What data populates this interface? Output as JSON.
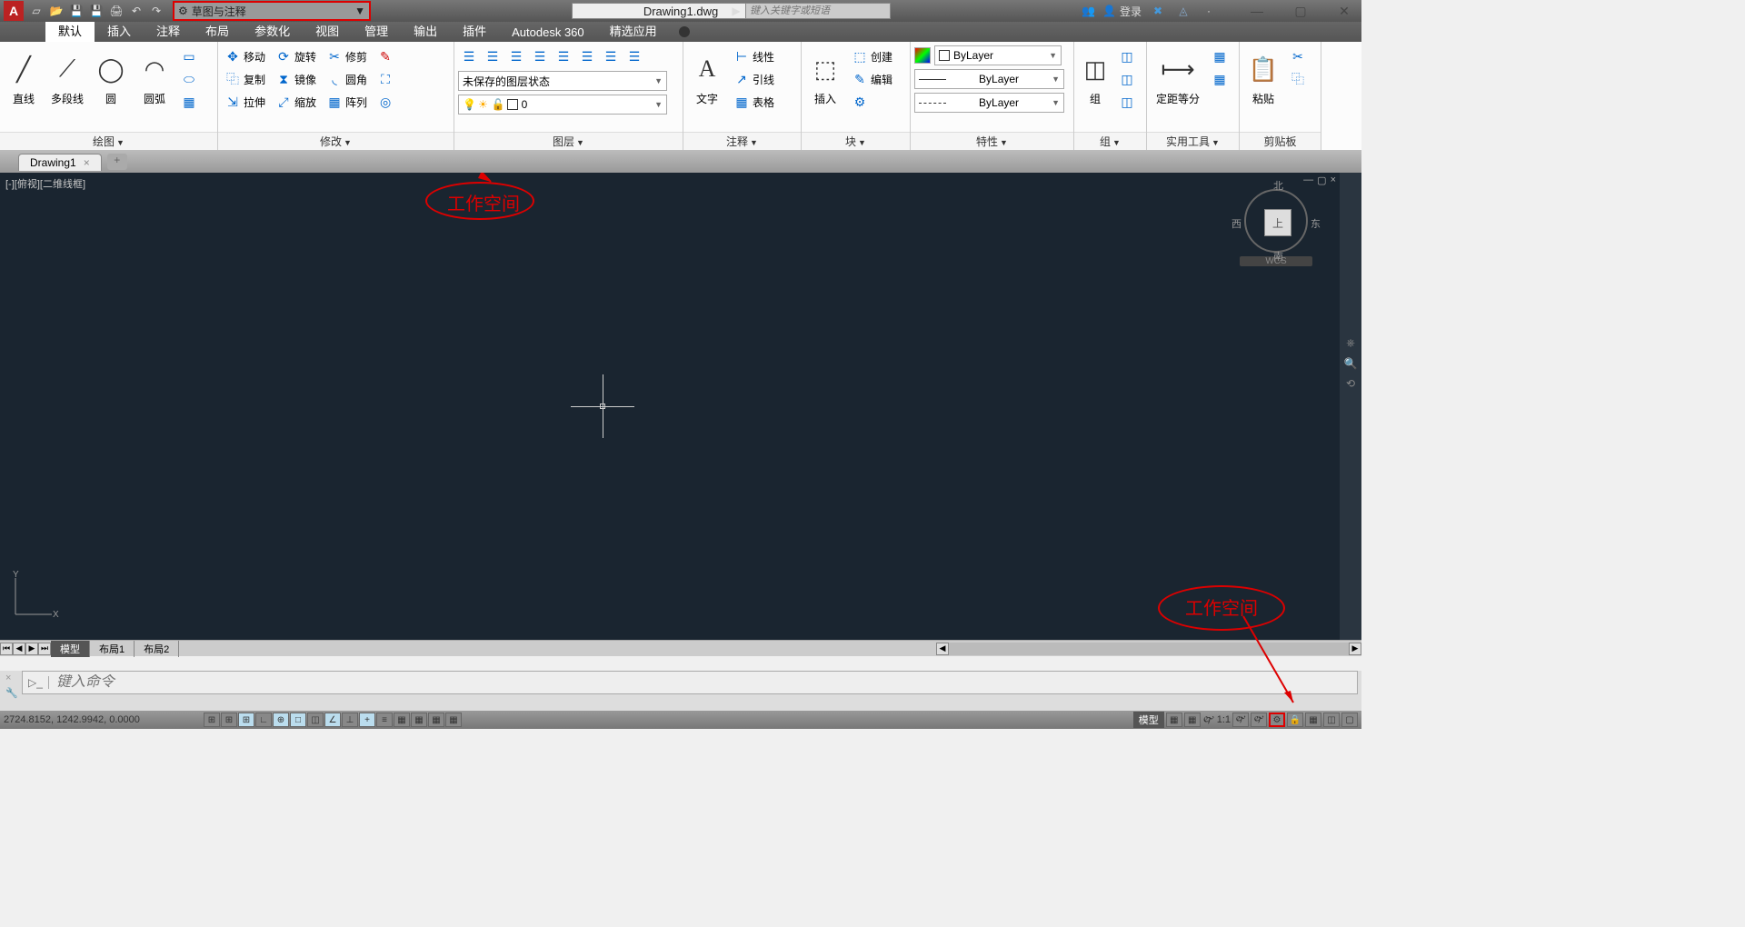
{
  "titlebar": {
    "filename": "Drawing1.dwg",
    "search_placeholder": "键入关键字或短语",
    "login": "登录"
  },
  "workspace": {
    "label": "草图与注释"
  },
  "ribbon_tabs": [
    {
      "label": "默认",
      "active": true
    },
    {
      "label": "插入",
      "active": false
    },
    {
      "label": "注释",
      "active": false
    },
    {
      "label": "布局",
      "active": false
    },
    {
      "label": "参数化",
      "active": false
    },
    {
      "label": "视图",
      "active": false
    },
    {
      "label": "管理",
      "active": false
    },
    {
      "label": "输出",
      "active": false
    },
    {
      "label": "插件",
      "active": false
    },
    {
      "label": "Autodesk 360",
      "active": false
    },
    {
      "label": "精选应用",
      "active": false
    }
  ],
  "panels": {
    "draw": {
      "title": "绘图",
      "items": {
        "line": "直线",
        "polyline": "多段线",
        "circle": "圆",
        "arc": "圆弧"
      }
    },
    "modify": {
      "title": "修改",
      "items": {
        "move": "移动",
        "rotate": "旋转",
        "trim": "修剪",
        "copy": "复制",
        "mirror": "镜像",
        "fillet": "圆角",
        "stretch": "拉伸",
        "scale": "缩放",
        "array": "阵列"
      }
    },
    "layers": {
      "title": "图层",
      "layer_state": "未保存的图层状态",
      "layer_current": "0"
    },
    "annotation": {
      "title": "注释",
      "text": "文字",
      "items": {
        "linear": "线性",
        "leader": "引线",
        "table": "表格"
      }
    },
    "block": {
      "title": "块",
      "insert": "插入",
      "items": {
        "create": "创建",
        "edit": "编辑"
      }
    },
    "properties": {
      "title": "特性",
      "bylayer": "ByLayer"
    },
    "group": {
      "title": "组",
      "group": "组"
    },
    "utilities": {
      "title": "实用工具",
      "measure": "定距等分"
    },
    "clipboard": {
      "title": "剪贴板",
      "paste": "粘贴"
    }
  },
  "file_tab": {
    "name": "Drawing1"
  },
  "viewport": {
    "label": "[-][俯视][二维线框]"
  },
  "viewcube": {
    "top": "上",
    "n": "北",
    "s": "南",
    "e": "东",
    "w": "西",
    "wcs": "WCS"
  },
  "layout_tabs": {
    "model": "模型",
    "layout1": "布局1",
    "layout2": "布局2"
  },
  "commandline": {
    "placeholder": "键入命令"
  },
  "statusbar": {
    "coords": "2724.8152, 1242.9942, 0.0000",
    "model": "模型",
    "scale": "1:1"
  },
  "annotations": {
    "workspace": "工作空间"
  }
}
